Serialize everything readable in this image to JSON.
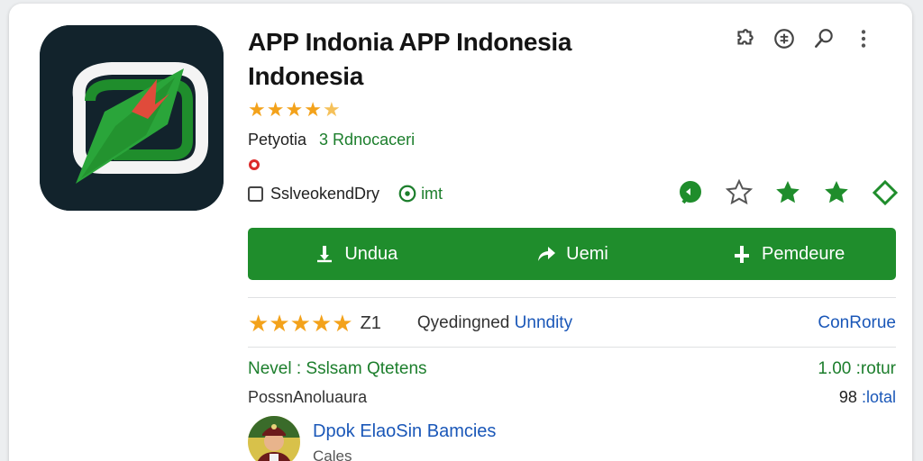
{
  "app": {
    "title_line1": "APP Indonia APP Indonesia",
    "title_line2": "Indonesia",
    "rating_stars": 4.5,
    "developer": "Petyotia",
    "downloads": "3 Rdnocaceri",
    "checkbox_label": "SslveokendDry",
    "tag_label": "imt"
  },
  "top_actions": [
    "puzzle-icon",
    "shield-icon",
    "search-icon",
    "more-vert-icon"
  ],
  "icon_row": [
    "chat-icon",
    "star-outline-icon",
    "star-filled-icon",
    "star-filled-icon",
    "diamond-outline-icon"
  ],
  "actions": {
    "download_label": "Undua",
    "share_label": "Uemi",
    "add_label": "Pemdeure"
  },
  "reviews": {
    "stars": 5,
    "count": "Z1",
    "label_part1": "Qyedingned",
    "label_part2": "Unndity",
    "link": "ConRorue"
  },
  "level": {
    "left": "Nevel : Sslsam Qtetens",
    "right": "1.00 :rotur"
  },
  "position": {
    "left": "PossnAnoluaura",
    "right_num": "98",
    "right_label": ":lotal"
  },
  "user": {
    "name": "Dpok ElaoSin Bamcies",
    "sub": "Cales"
  },
  "colors": {
    "brand_green": "#1f8d2c",
    "link_blue": "#1a57b8",
    "star_orange": "#f3a21b",
    "icon_bg": "#12232c"
  }
}
